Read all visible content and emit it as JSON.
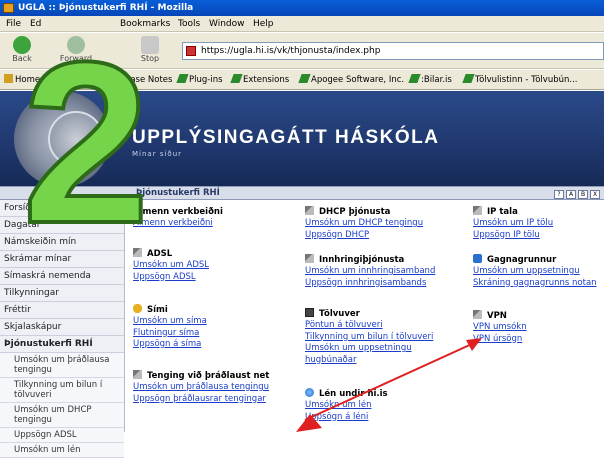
{
  "window": {
    "title": "UGLA :: Þjónustukerfi RHÍ - Mozilla"
  },
  "menu": {
    "items": [
      "File",
      "Ed",
      "Bookmarks",
      "Tools",
      "Window",
      "Help"
    ]
  },
  "nav": {
    "back": "Back",
    "forward": "Forward",
    "stop": "Stop",
    "url": "https://ugla.hi.is/vk/thjonusta/index.php"
  },
  "bookmarks": {
    "home": "Home",
    "items": [
      "Bookmarks",
      "Release Notes",
      "Plug-ins",
      "Extensions",
      "Apogee Software, Inc.",
      ":Bilar.is",
      "Tölvulistinn - Tölvubún..."
    ]
  },
  "banner": {
    "title": "UPPLÝSINGAGÁTT HÁSKÓLA",
    "subtitle": "Mínar síður"
  },
  "breadcrumb": {
    "text": "Þjónustukerfi RHÍ",
    "icons": [
      "?",
      "A",
      "B",
      "X"
    ]
  },
  "sidebar": {
    "items": [
      "Forsíða",
      "Dagatal",
      "Námskeiðin mín",
      "Skrámar mínar",
      "Símaskrá nemenda",
      "Tilkynningar",
      "Fréttir",
      "Skjalaskápur",
      "Þjónustukerfi RHÍ"
    ],
    "subitems": [
      "Umsókn um þráðlausa tengingu",
      "Tilkynning um bilun í tölvuveri",
      "Umsókn um DHCP tengingu",
      "Uppsögn ADSL",
      "Umsókn um lén"
    ]
  },
  "sections": {
    "almenn": {
      "title": "Almenn verkbeiðni",
      "links": [
        "Almenn verkbeiðni"
      ]
    },
    "adsl": {
      "title": "ADSL",
      "links": [
        "Umsókn um ADSL",
        "Uppsögn ADSL"
      ]
    },
    "simi": {
      "title": "Sími",
      "links": [
        "Umsókn um síma",
        "Flutningur síma",
        "Uppsögn á síma"
      ]
    },
    "tenging": {
      "title": "Tenging við þráðlaust net",
      "links": [
        "Umsókn um þráðlausa tengingu",
        "Uppsögn þráðlausrar tengingar"
      ]
    },
    "dhcp": {
      "title": "DHCP þjónusta",
      "links": [
        "Umsókn um DHCP tengingu",
        "Uppsögn DHCP"
      ]
    },
    "innhringi": {
      "title": "Innhringiþjónusta",
      "links": [
        "Umsókn um innhringisamband",
        "Uppsögn innhringisambands"
      ]
    },
    "tolvuver": {
      "title": "Tölvuver",
      "links": [
        "Pöntun á tölvuveri",
        "Tilkynning um bilun í tölvuveri",
        "Umsókn um uppsetningu",
        "hugbúnaðar"
      ]
    },
    "len": {
      "title": "Lén undir hi.is",
      "links": [
        "Umsókn um lén",
        "Uppsögn á léni"
      ]
    },
    "ip": {
      "title": "IP tala",
      "links": [
        "Umsókn um IP tölu",
        "Uppsögn IP tölu"
      ]
    },
    "gagna": {
      "title": "Gagnagrunnur",
      "links": [
        "Umsókn um uppsetningu",
        "Skráning gagnagrunns notan"
      ]
    },
    "vpn": {
      "title": "VPN",
      "links": [
        "VPN umsókn",
        "VPN úrsögn"
      ]
    }
  },
  "annotation": {
    "step_number": "2",
    "numeral_color": "#76d44a",
    "arrow_color": "#e02020"
  },
  "colors": {
    "banner": "#1d3468",
    "link": "#1a3cc8",
    "titlebar": "#0a5fd8"
  }
}
